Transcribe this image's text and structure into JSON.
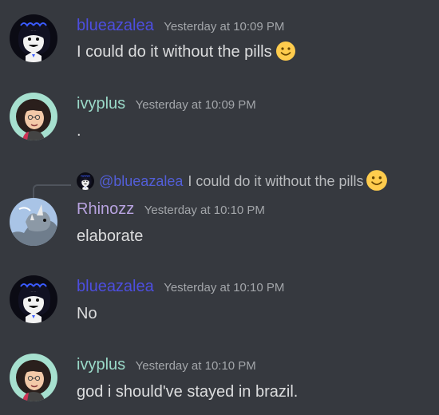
{
  "colors": {
    "background": "#36393f",
    "username_blueazalea": "#4d4ee0",
    "username_ivyplus": "#9ad9c8",
    "username_rhinozz": "#b8a3e0",
    "timestamp": "#a3a6aa",
    "message_text": "#dcddde",
    "mention": "#5865f2"
  },
  "messages": [
    {
      "username": "blueazalea",
      "timestamp": "Yesterday at 10:09 PM",
      "text": "I could do it without the pills",
      "emoji": "slightly-smiling-face",
      "avatar": "blueazalea-avatar"
    },
    {
      "username": "ivyplus",
      "timestamp": "Yesterday at 10:09 PM",
      "text": ".",
      "avatar": "ivyplus-avatar"
    },
    {
      "reply": {
        "mention": "@blueazalea",
        "text": "I could do it without the pills",
        "emoji": "slightly-smiling-face"
      },
      "username": "Rhinozz",
      "timestamp": "Yesterday at 10:10 PM",
      "text": "elaborate",
      "avatar": "rhinozz-avatar"
    },
    {
      "username": "blueazalea",
      "timestamp": "Yesterday at 10:10 PM",
      "text": "No",
      "avatar": "blueazalea-avatar"
    },
    {
      "username": "ivyplus",
      "timestamp": "Yesterday at 10:10 PM",
      "text": "god i should've stayed in brazil.",
      "avatar": "ivyplus-avatar"
    }
  ]
}
